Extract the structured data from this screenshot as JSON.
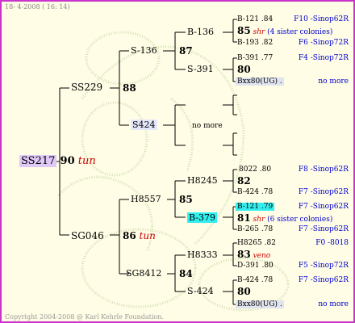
{
  "header": {
    "date": "18- 4-2008 ( 16: 14)"
  },
  "footer": {
    "copyright": "Copyright 2004-2008 @ Karl Kehrle Foundation."
  },
  "tree": {
    "root": {
      "name": "SS217",
      "num": "90",
      "tag": "tun"
    },
    "p1": {
      "name": "SS229",
      "num": "88"
    },
    "p2": {
      "name": "SG046",
      "num": "86",
      "tag": "tun"
    },
    "g1": {
      "name": "S-136",
      "num": "87"
    },
    "g2": {
      "name": "S424",
      "more": "no more"
    },
    "g3": {
      "name": "H8557",
      "num": "85"
    },
    "g4": {
      "name": "SG8412",
      "num": "84"
    },
    "gg1": {
      "name": "B-136"
    },
    "gg2": {
      "name": "S-391"
    },
    "gg3": {
      "name": "H8245"
    },
    "gg4": {
      "name": "B-379"
    },
    "gg5": {
      "name": "H8333"
    },
    "gg6": {
      "name": "S-424"
    }
  },
  "leaves": [
    {
      "line1": "B-121 .84",
      "src1": "F10 -Sinop62R",
      "num": "85",
      "tag": "shr",
      "note": "(4 sister colonies)",
      "line2": "B-193 .82",
      "src2": "F6 -Sinop72R"
    },
    {
      "line1": "B-391 .77",
      "src1": "F4 -Sinop72R",
      "num": "80",
      "tag": "",
      "note": "",
      "line2": "Bxx80(UG) .",
      "src2": "no more"
    },
    {
      "line1": "8022 .80",
      "src1": "F8 -Sinop62R",
      "num": "82",
      "tag": "",
      "note": "",
      "line2": "B-424 .78",
      "src2": "F7 -Sinop62R"
    },
    {
      "line1": "B-121 .79",
      "src1": "F7 -Sinop62R",
      "num": "81",
      "tag": "shr",
      "note": "(6 sister colonies)",
      "line2": "B-265 .78",
      "src2": "F7 -Sinop62R"
    },
    {
      "line1": "H8265 .82",
      "src1": "F0 -8018",
      "num": "83",
      "tag": "veno",
      "note": "",
      "line2": "D-391 .80",
      "src2": "F5 -Sinop72R"
    },
    {
      "line1": "B-424 .78",
      "src1": "F7 -Sinop62R",
      "num": "80",
      "tag": "",
      "note": "",
      "line2": "Bxx80(UG) .",
      "src2": "no more"
    }
  ],
  "colors": {
    "border": "#cc33cc",
    "background": "#fffde6",
    "red_tag": "#cc0000",
    "source_blue": "#0000cc",
    "highlight_cyan": "#33eeee",
    "highlight_purple": "#e0c8f8"
  }
}
